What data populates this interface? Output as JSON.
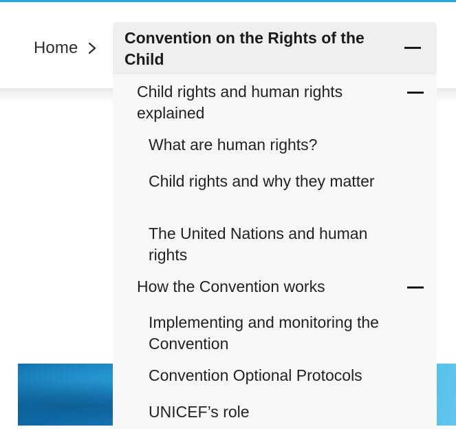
{
  "breadcrumb": {
    "home_label": "Home",
    "separator_icon": "chevron-right-icon"
  },
  "dropdown": {
    "title": "Convention on the Rights of the Child",
    "toggle_icon": "minus-icon",
    "sections": [
      {
        "label": "Child rights and human rights explained",
        "expanded": true,
        "toggle_icon": "minus-icon",
        "items": [
          "What are human rights?",
          "Child rights and why they matter",
          "The United Nations and human rights"
        ]
      },
      {
        "label": "How the Convention works",
        "expanded": true,
        "toggle_icon": "minus-icon",
        "items": [
          "Implementing and monitoring the Convention",
          "Convention Optional Protocols",
          "UNICEF’s role"
        ]
      }
    ]
  },
  "colors": {
    "accent": "#1cabe2",
    "header_bg": "#efefef",
    "panel_bg": "#f7f7f7",
    "text": "#1a1a1a"
  }
}
